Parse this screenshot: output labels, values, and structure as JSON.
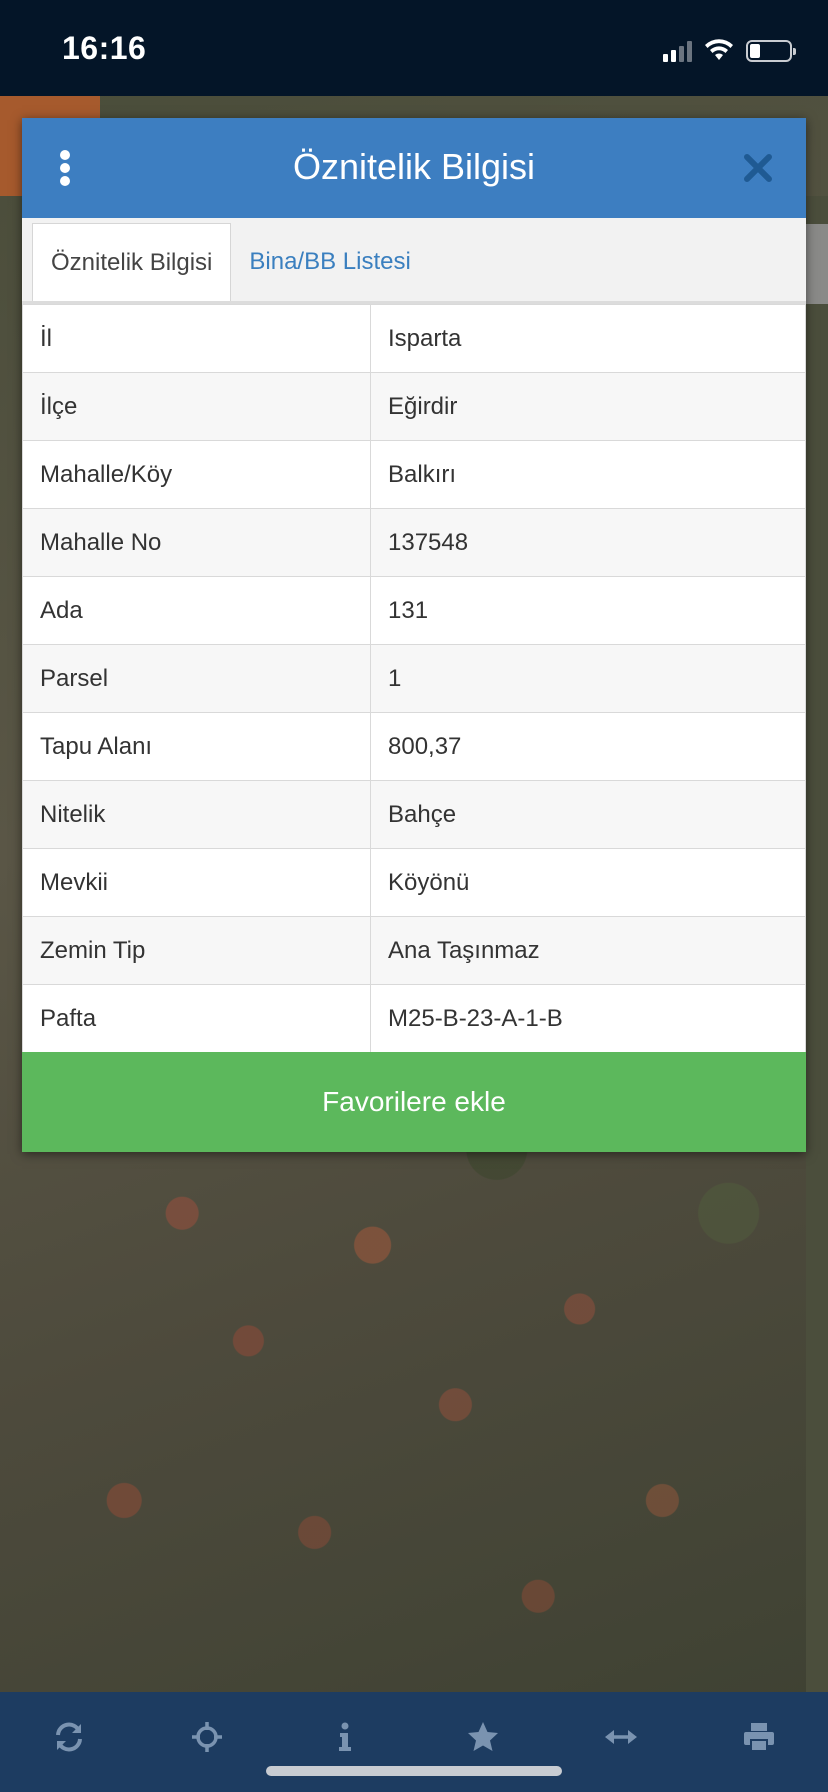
{
  "status_bar": {
    "time": "16:16"
  },
  "modal": {
    "title": "Öznitelik Bilgisi",
    "tabs": [
      {
        "label": "Öznitelik Bilgisi",
        "active": true
      },
      {
        "label": "Bina/BB Listesi",
        "active": false
      }
    ],
    "rows": [
      {
        "key": "İl",
        "value": "Isparta"
      },
      {
        "key": "İlçe",
        "value": "Eğirdir"
      },
      {
        "key": "Mahalle/Köy",
        "value": "Balkırı"
      },
      {
        "key": "Mahalle No",
        "value": "137548"
      },
      {
        "key": "Ada",
        "value": "131"
      },
      {
        "key": "Parsel",
        "value": "1"
      },
      {
        "key": "Tapu Alanı",
        "value": "800,37"
      },
      {
        "key": "Nitelik",
        "value": "Bahçe"
      },
      {
        "key": "Mevkii",
        "value": "Köyönü"
      },
      {
        "key": "Zemin Tip",
        "value": "Ana Taşınmaz"
      },
      {
        "key": "Pafta",
        "value": "M25-B-23-A-1-B"
      }
    ],
    "favorite_button": "Favorilere ekle"
  },
  "toolbar": {
    "icons": [
      "refresh-icon",
      "locate-icon",
      "info-icon",
      "star-icon",
      "measure-icon",
      "print-icon"
    ]
  },
  "colors": {
    "header": "#3d7ec1",
    "button": "#5cb85c",
    "toolbar": "#1d3c61",
    "tab_inactive_text": "#3a7fbf"
  }
}
